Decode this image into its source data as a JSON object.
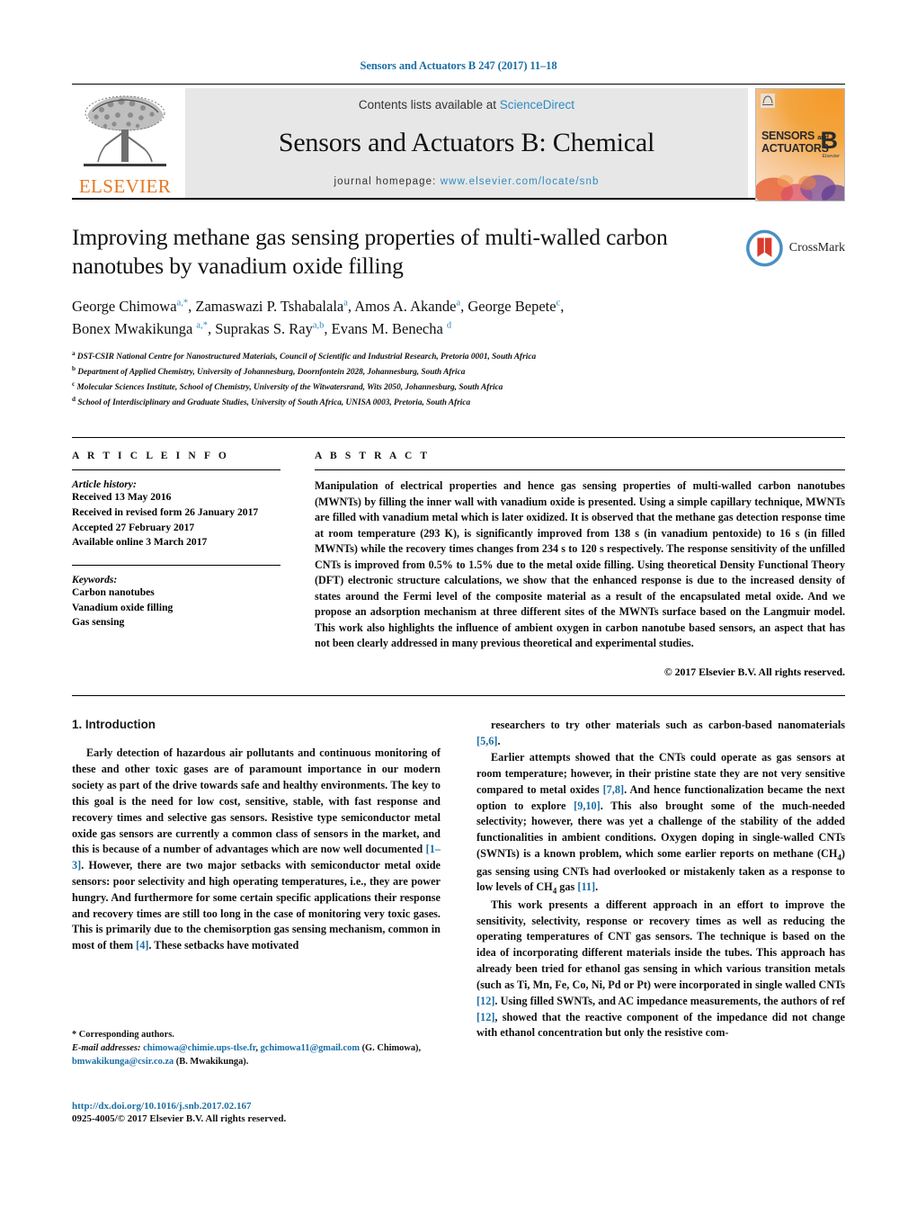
{
  "running_head": "Sensors and Actuators B 247 (2017) 11–18",
  "masthead": {
    "contents_prefix": "Contents lists available at",
    "contents_link": "ScienceDirect",
    "journal_title": "Sensors and Actuators B: Chemical",
    "homepage_prefix": "journal homepage:",
    "homepage_url": "www.elsevier.com/locate/snb",
    "publisher": "ELSEVIER",
    "cover": {
      "line1": "SENSORS",
      "and": "and",
      "line2": "ACTUATORS",
      "letter": "B",
      "sublabel": "Elsevier"
    }
  },
  "article": {
    "title": "Improving methane gas sensing properties of multi-walled carbon nanotubes by vanadium oxide filling",
    "authors_line1": "George Chimowa<sup>a,</sup><sup>*</sup>, Zamaswazi P. Tshabalala<sup>a</sup>, Amos A. Akande<sup>a</sup>, George Bepete<sup>c</sup>,",
    "authors_line2": "Bonex Mwakikunga <sup>a,</sup><sup>*</sup>, Suprakas S. Ray<sup>a,b</sup>, Evans M. Benecha <sup>d</sup>",
    "affiliations": [
      {
        "mark": "a",
        "text": "DST-CSIR National Centre for Nanostructured Materials, Council of Scientific and Industrial Research, Pretoria 0001, South Africa"
      },
      {
        "mark": "b",
        "text": "Department of Applied Chemistry, University of Johannesburg, Doornfontein 2028, Johannesburg, South Africa"
      },
      {
        "mark": "c",
        "text": "Molecular Sciences Institute, School of Chemistry, University of the Witwatersrand, Wits 2050, Johannesburg, South Africa"
      },
      {
        "mark": "d",
        "text": "School of Interdisciplinary and Graduate Studies, University of South Africa, UNISA 0003, Pretoria, South Africa"
      }
    ],
    "crossmark_label": "CrossMark"
  },
  "article_info": {
    "heading": "A R T I C L E    I N F O",
    "history_label": "Article history:",
    "history": [
      "Received 13 May 2016",
      "Received in revised form 26 January 2017",
      "Accepted 27 February 2017",
      "Available online 3 March 2017"
    ],
    "keywords_label": "Keywords:",
    "keywords": [
      "Carbon nanotubes",
      "Vanadium oxide filling",
      "Gas sensing"
    ]
  },
  "abstract": {
    "heading": "A B S T R A C T",
    "text": "Manipulation of electrical properties and hence gas sensing properties of multi-walled carbon nanotubes (MWNTs) by filling the inner wall with vanadium oxide is presented. Using a simple capillary technique, MWNTs are filled with vanadium metal which is later oxidized. It is observed that the methane gas detection response time at room temperature (293 K), is significantly improved from 138 s (in vanadium pentoxide) to 16 s (in filled MWNTs) while the recovery times changes from 234 s to 120 s respectively. The response sensitivity of the unfilled CNTs is improved from 0.5% to 1.5% due to the metal oxide filling. Using theoretical Density Functional Theory (DFT) electronic structure calculations, we show that the enhanced response is due to the increased density of states around the Fermi level of the composite material as a result of the encapsulated metal oxide. And we propose an adsorption mechanism at three different sites of the MWNTs surface based on the Langmuir model. This work also highlights the influence of ambient oxygen in carbon nanotube based sensors, an aspect that has not been clearly addressed in many previous theoretical and experimental studies.",
    "copyright": "© 2017 Elsevier B.V. All rights reserved."
  },
  "body": {
    "section_heading": "1.  Introduction",
    "left_paragraphs": [
      "Early detection of hazardous air pollutants and continuous monitoring of these and other toxic gases are of paramount importance in our modern society as part of the drive towards safe and healthy environments. The key to this goal is the need for low cost, sensitive, stable, with fast response and recovery times and selective gas sensors. Resistive type semiconductor metal oxide gas sensors are currently a common class of sensors in the market, and this is because of a number of advantages which are now well documented <span class=\"ref\">[1–3]</span>. However, there are two major setbacks with semiconductor metal oxide sensors: poor selectivity and high operating temperatures, i.e., they are power hungry. And furthermore for some certain specific applications their response and recovery times are still too long in the case of monitoring very toxic gases. This is primarily due to the chemisorption gas sensing mechanism, common in most of them <span class=\"ref\">[4]</span>. These setbacks have motivated"
    ],
    "right_paragraphs": [
      "researchers to try other materials such as carbon-based nanomaterials <span class=\"ref\">[5,6]</span>.",
      "Earlier attempts showed that the CNTs could operate as gas sensors at room temperature; however, in their pristine state they are not very sensitive compared to metal oxides <span class=\"ref\">[7,8]</span>. And hence functionalization became the next option to explore <span class=\"ref\">[9,10]</span>. This also brought some of the much-needed selectivity; however, there was yet a challenge of the stability of the added functionalities in ambient conditions. Oxygen doping in single-walled CNTs (SWNTs) is a known problem, which some earlier reports on methane (CH<sub>4</sub>) gas sensing using CNTs had overlooked or mistakenly taken as a response to low levels of CH<sub>4</sub> gas <span class=\"ref\">[11]</span>.",
      "This work presents a different approach in an effort to improve the sensitivity, selectivity, response or recovery times as well as reducing the operating temperatures of CNT gas sensors. The technique is based on the idea of incorporating different materials inside the tubes. This approach has already been tried for ethanol gas sensing in which various transition metals (such as Ti, Mn, Fe, Co, Ni, Pd or Pt) were incorporated in single walled CNTs <span class=\"ref\">[12]</span>. Using filled SWNTs, and AC impedance measurements, the authors of ref <span class=\"ref\">[12]</span>, showed that the reactive component of the impedance did not change with ethanol concentration but only the resistive com-"
    ]
  },
  "footnote": {
    "corresponding": "*  Corresponding authors.",
    "email_label": "E-mail addresses:",
    "emails_html": "<span class=\"fn-link\">chimowa@chimie.ups-tlse.fr</span>, <span class=\"fn-link\">gchimowa11@gmail.com</span> (G. Chimowa), <span class=\"fn-link\">bmwakikunga@csir.co.za</span> (B. Mwakikunga)."
  },
  "footer": {
    "doi": "http://dx.doi.org/10.1016/j.snb.2017.02.167",
    "issn": "0925-4005/© 2017 Elsevier B.V. All rights reserved."
  },
  "colors": {
    "link_blue": "#1a6ea5",
    "science_direct_blue": "#2e8bc0",
    "elsevier_orange": "#E87722",
    "masthead_grey": "#e7e7e7"
  }
}
